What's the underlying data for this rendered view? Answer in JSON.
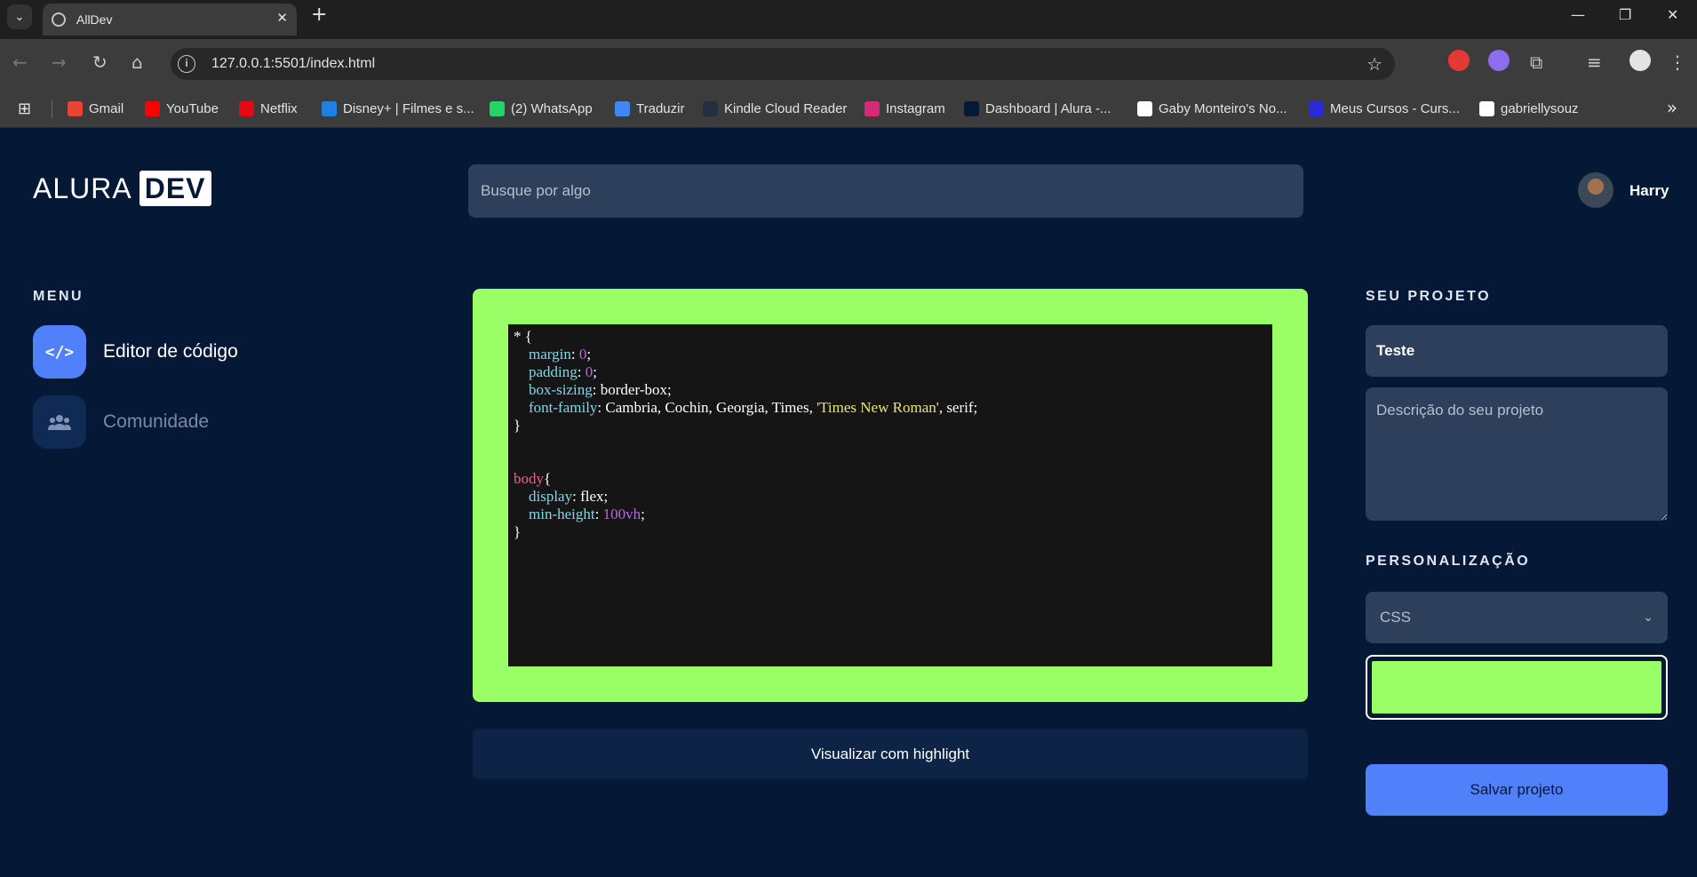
{
  "browser": {
    "tab_title": "AllDev",
    "url": "127.0.0.1:5501/index.html",
    "bookmarks": [
      {
        "label": "Gmail",
        "color": "#ea4335"
      },
      {
        "label": "YouTube",
        "color": "#ff0000"
      },
      {
        "label": "Netflix",
        "color": "#e50914"
      },
      {
        "label": "Disney+ | Filmes e s...",
        "color": "#1f80e0"
      },
      {
        "label": "(2) WhatsApp",
        "color": "#25d366"
      },
      {
        "label": "Traduzir",
        "color": "#4285f4"
      },
      {
        "label": "Kindle Cloud Reader",
        "color": "#232f3e"
      },
      {
        "label": "Instagram",
        "color": "#d62976"
      },
      {
        "label": "Dashboard | Alura -...",
        "color": "#051937"
      },
      {
        "label": "Gaby Monteiro's No...",
        "color": "#ffffff"
      },
      {
        "label": "Meus Cursos - Curs...",
        "color": "#2a2ad8"
      },
      {
        "label": "gabriellysouz",
        "color": "#ffffff"
      }
    ]
  },
  "header": {
    "logo_primary": "ALURA",
    "logo_secondary": "DEV",
    "search_placeholder": "Busque por algo",
    "user_name": "Harry"
  },
  "menu": {
    "title": "MENU",
    "items": [
      {
        "label": "Editor de código",
        "icon": "code-icon",
        "active": true
      },
      {
        "label": "Comunidade",
        "icon": "users-icon",
        "active": false
      }
    ]
  },
  "editor": {
    "frame_color": "#9aff66",
    "highlight_button": "Visualizar com highlight"
  },
  "project": {
    "title": "SEU PROJETO",
    "name_value": "Teste",
    "description_placeholder": "Descrição do seu projeto",
    "customization_title": "PERSONALIZAÇÃO",
    "language_selected": "CSS",
    "color_value": "#9aff66",
    "save_button": "Salvar projeto"
  },
  "colors": {
    "background": "#051937",
    "accent": "#5081fb",
    "field_bg": "#2d3f5b"
  }
}
